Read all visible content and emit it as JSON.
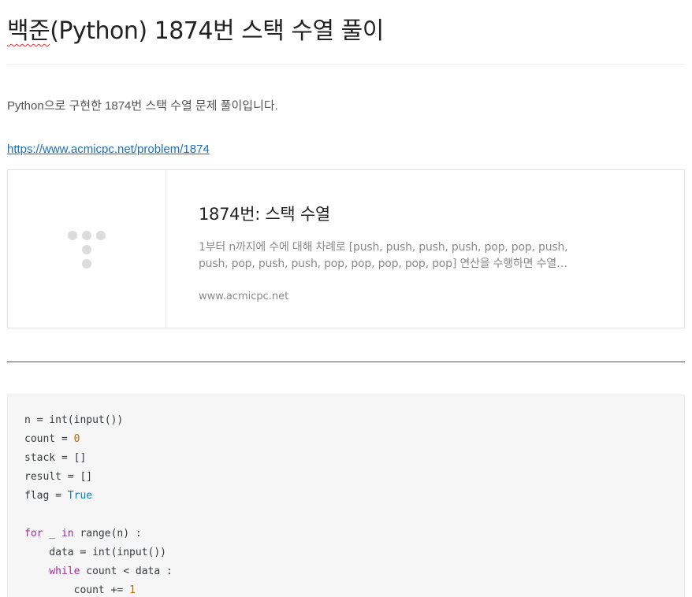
{
  "post": {
    "title_prefix": "백준",
    "title_rest": "(Python) 1874번 스택 수열 풀이",
    "intro": "Python으로 구현한 1874번 스택 수열 문제 풀이입니다.",
    "link": "https://www.acmicpc.net/problem/1874"
  },
  "og_card": {
    "title": "1874번: 스택 수열",
    "description": "1부터 n까지에 수에 대해 차례로 [push, push, push, push, pop, pop, push, push, pop, push, push, pop, pop, pop, pop, pop] 연산을 수행하면 수열 [4…",
    "host": "www.acmicpc.net",
    "placeholder_icon": "logo-dots-icon"
  },
  "code": {
    "language": "python",
    "lines": [
      [
        {
          "t": "n = int(input())",
          "c": ""
        }
      ],
      [
        {
          "t": "count = ",
          "c": ""
        },
        {
          "t": "0",
          "c": "num"
        }
      ],
      [
        {
          "t": "stack = []",
          "c": ""
        }
      ],
      [
        {
          "t": "result = []",
          "c": ""
        }
      ],
      [
        {
          "t": "flag = ",
          "c": ""
        },
        {
          "t": "True",
          "c": "bool"
        }
      ],
      [
        {
          "t": "",
          "c": ""
        }
      ],
      [
        {
          "t": "for",
          "c": "kw"
        },
        {
          "t": " _ ",
          "c": ""
        },
        {
          "t": "in",
          "c": "kw"
        },
        {
          "t": " range(n) :",
          "c": ""
        }
      ],
      [
        {
          "t": "    data = int(input())",
          "c": ""
        }
      ],
      [
        {
          "t": "    ",
          "c": ""
        },
        {
          "t": "while",
          "c": "kw"
        },
        {
          "t": " count < data :",
          "c": ""
        }
      ],
      [
        {
          "t": "        count += ",
          "c": ""
        },
        {
          "t": "1",
          "c": "num"
        }
      ]
    ]
  },
  "colors": {
    "link": "#1a6fc2",
    "code_background": "#f6f6f6",
    "keyword": "#a626a4",
    "number": "#b76b01",
    "boolean": "#0184bc"
  }
}
